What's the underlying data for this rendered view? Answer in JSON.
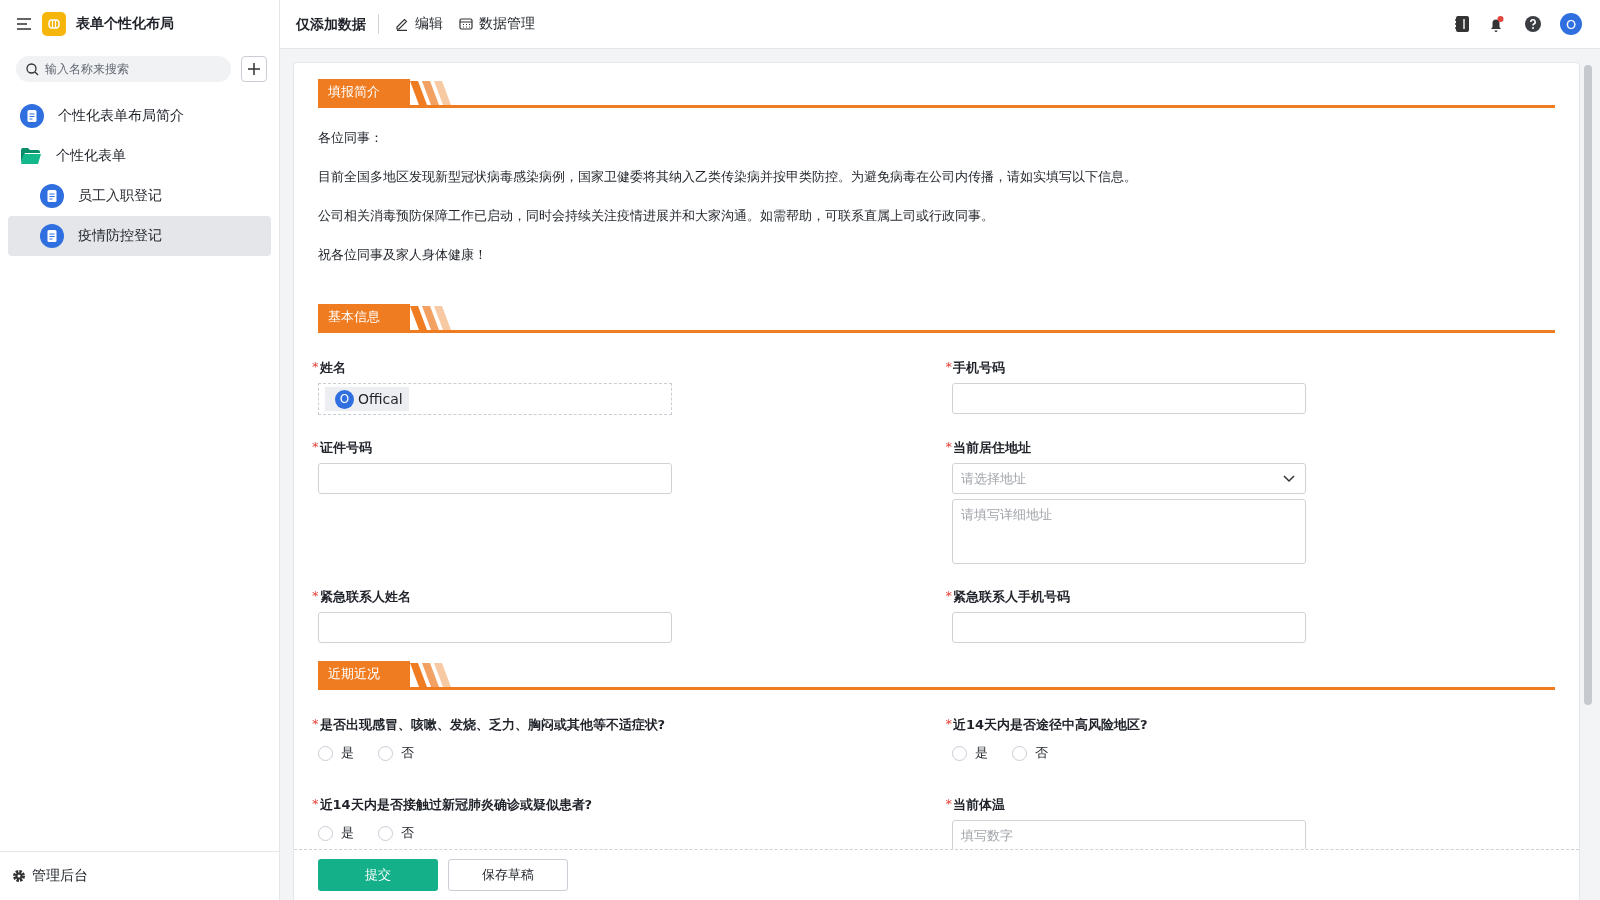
{
  "app": {
    "title": "表单个性化布局"
  },
  "required_mark": "*",
  "sidebar": {
    "search": {
      "placeholder": "输入名称来搜索"
    },
    "items": [
      {
        "label": "个性化表单布局简介",
        "kind": "doc",
        "selected": false
      },
      {
        "label": "个性化表单",
        "kind": "folder",
        "selected": false,
        "children": [
          {
            "label": "员工入职登记",
            "kind": "doc",
            "selected": false
          },
          {
            "label": "疫情防控登记",
            "kind": "doc",
            "selected": true
          }
        ]
      }
    ],
    "footer": "管理后台"
  },
  "topbar": {
    "title": "仅添加数据",
    "actions": [
      {
        "label": "编辑",
        "kind": "edit"
      },
      {
        "label": "数据管理",
        "kind": "table"
      }
    ],
    "avatar": "O"
  },
  "sections": [
    {
      "title": "填报简介",
      "kind": "text",
      "paragraphs": [
        "各位同事：",
        "目前全国多地区发现新型冠状病毒感染病例，国家卫健委将其纳入乙类传染病并按甲类防控。为避免病毒在公司内传播，请如实填写以下信息。",
        "公司相关消毒预防保障工作已启动，同时会持续关注疫情进展并和大家沟通。如需帮助，可联系直属上司或行政同事。",
        "祝各位同事及家人身体健康！"
      ]
    },
    {
      "title": "基本信息",
      "kind": "fields",
      "fields": [
        {
          "label": "姓名",
          "required": true,
          "kind": "person",
          "avatar": "O",
          "value": "Offical"
        },
        {
          "label": "手机号码",
          "required": true,
          "kind": "input"
        },
        {
          "label": "证件号码",
          "required": true,
          "kind": "input"
        },
        {
          "label": "当前居住地址",
          "required": true,
          "kind": "address",
          "placeholder": "请选择地址",
          "detail_placeholder": "请填写详细地址"
        },
        {
          "label": "紧急联系人姓名",
          "required": true,
          "kind": "input"
        },
        {
          "label": "紧急联系人手机号码",
          "required": true,
          "kind": "input"
        }
      ]
    },
    {
      "title": "近期近况",
      "kind": "fields",
      "fields": [
        {
          "label": "是否出现感冒、咳嗽、发烧、乏力、胸闷或其他等不适症状?",
          "required": true,
          "kind": "radio",
          "options": [
            {
              "label": "是",
              "selected": false
            },
            {
              "label": "否",
              "selected": false
            }
          ]
        },
        {
          "label": "近14天内是否途径中高风险地区?",
          "required": true,
          "kind": "radio",
          "options": [
            {
              "label": "是",
              "selected": false
            },
            {
              "label": "否",
              "selected": false
            }
          ]
        },
        {
          "label": "近14天内是否接触过新冠肺炎确诊或疑似患者?",
          "required": true,
          "kind": "radio",
          "options": [
            {
              "label": "是",
              "selected": false
            },
            {
              "label": "否",
              "selected": false
            }
          ]
        },
        {
          "label": "当前体温",
          "required": true,
          "kind": "input",
          "placeholder": "填写数字"
        }
      ]
    }
  ],
  "buttons": [
    {
      "label": "提交",
      "kind": "primary"
    },
    {
      "label": "保存草稿",
      "kind": "default"
    }
  ]
}
